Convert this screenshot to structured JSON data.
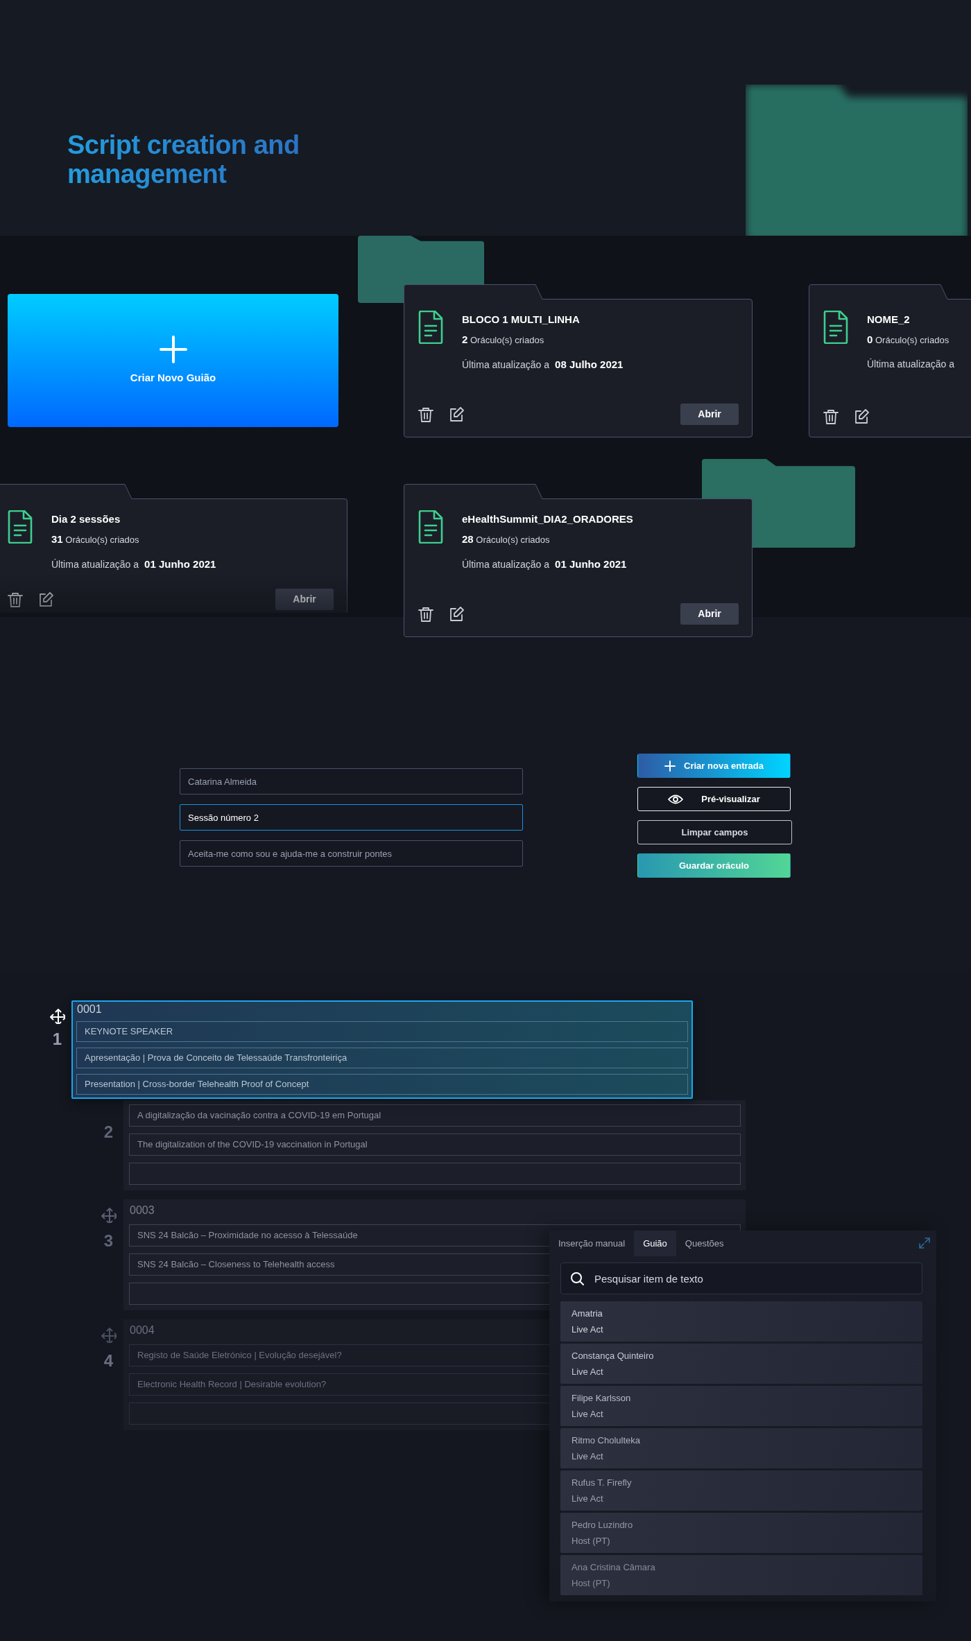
{
  "hero": {
    "title": "Script creation and management"
  },
  "create_card": {
    "label": "Criar Novo Guião"
  },
  "scripts": [
    {
      "name": "BLOCO 1 MULTI_LINHA",
      "count": "2",
      "count_label": "Oráculo(s) criados",
      "updated_label": "Última atualização a",
      "date": "08 Julho 2021",
      "open_label": "Abrir"
    },
    {
      "name": "NOME_2",
      "count": "0",
      "count_label": "Oráculo(s) criados",
      "updated_label": "Última atualização a"
    },
    {
      "name": "Dia 2 sessões",
      "count": "31",
      "count_label": "Oráculo(s) criados",
      "updated_label": "Última atualização a",
      "date": "01 Junho 2021",
      "open_label": "Abrir"
    },
    {
      "name": "eHealthSummit_DIA2_ORADORES",
      "count": "28",
      "count_label": "Oráculo(s) criados",
      "updated_label": "Última atualização a",
      "date": "01 Junho 2021",
      "open_label": "Abrir"
    }
  ],
  "form": {
    "fields": [
      {
        "placeholder": "Catarina Almeida",
        "focused": false
      },
      {
        "value": "Sessão número 2",
        "focused": true
      },
      {
        "placeholder": "Aceita-me como sou e ajuda-me a construir pontes",
        "focused": false
      }
    ],
    "buttons": [
      {
        "kind": "create",
        "label": "Criar nova entrada"
      },
      {
        "kind": "preview",
        "label": "Pré-visualizar"
      },
      {
        "kind": "clear",
        "label": "Limpar campos"
      },
      {
        "kind": "save",
        "label": "Guardar oráculo"
      }
    ]
  },
  "entries": [
    {
      "number": "1",
      "id": "0001",
      "selected": true,
      "dimmed": false,
      "fields": [
        {
          "kind": "text",
          "value": "KEYNOTE SPEAKER"
        },
        {
          "kind": "text",
          "value": "Apresentação | Prova de Conceito de Telessaúde Transfronteiriça"
        },
        {
          "kind": "text",
          "value": "Presentation | Cross-border Telehealth Proof of Concept"
        }
      ]
    },
    {
      "number": "2",
      "selected": false,
      "dimmed": false,
      "fields": [
        {
          "kind": "text",
          "value": "A digitalização da vacinação contra a COVID-19 em Portugal"
        },
        {
          "kind": "text",
          "value": "The digitalization of the COVID-19 vaccination in Portugal"
        },
        {
          "kind": "blank"
        }
      ]
    },
    {
      "number": "3",
      "id": "0003",
      "selected": false,
      "dimmed": false,
      "fields": [
        {
          "kind": "text",
          "value": "SNS 24 Balcão – Proximidade no acesso à Telessaúde"
        },
        {
          "kind": "text",
          "value": "SNS 24 Balcão – Closeness to Telehealth access"
        },
        {
          "kind": "blank"
        }
      ]
    },
    {
      "number": "4",
      "id": "0004",
      "selected": false,
      "dimmed": true,
      "fields": [
        {
          "kind": "text",
          "value": "Registo de Saúde Eletrónico | Evolução desejável?"
        },
        {
          "kind": "text",
          "value": "Electronic Health Record | Desirable evolution?"
        },
        {
          "kind": "blank"
        }
      ]
    }
  ],
  "panel": {
    "tabs": [
      {
        "label": "Inserção manual",
        "selected": false
      },
      {
        "label": "Guião",
        "selected": true
      },
      {
        "label": "Questões",
        "selected": false
      }
    ],
    "search": {
      "placeholder": "Pesquisar item de texto"
    },
    "items": [
      {
        "name": "Amatria",
        "role": "Live Act"
      },
      {
        "name": "Constança Quinteiro",
        "role": "Live Act"
      },
      {
        "name": "Filipe Karlsson",
        "role": "Live Act"
      },
      {
        "name": "Ritmo Cholulteka",
        "role": "Live Act"
      },
      {
        "name": "Rufus T. Firefly",
        "role": "Live Act"
      },
      {
        "name": "Pedro Luzindro",
        "role": "Host (PT)"
      },
      {
        "name": "Ana Cristina Câmara",
        "role": "Host (PT)"
      }
    ]
  }
}
